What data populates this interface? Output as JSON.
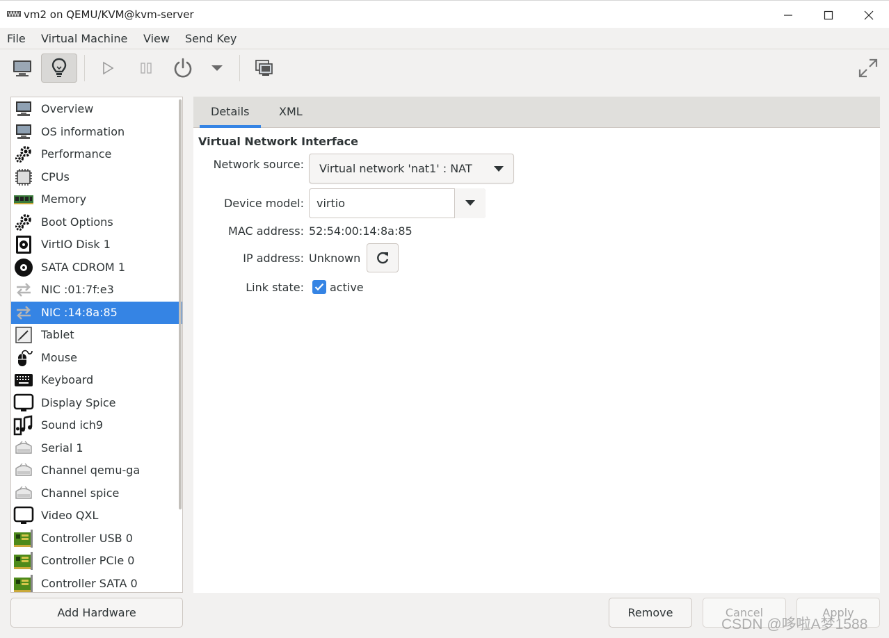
{
  "window": {
    "title": "vm2 on QEMU/KVM@kvm-server",
    "minimize": "—",
    "maximize": "☐",
    "close": "✕"
  },
  "menubar": {
    "items": [
      "File",
      "Virtual Machine",
      "View",
      "Send Key"
    ]
  },
  "toolbar": {
    "buttons": [
      {
        "name": "console",
        "icon": "monitor-icon",
        "active": false
      },
      {
        "name": "details",
        "icon": "lightbulb-icon",
        "active": true
      },
      {
        "name": "run",
        "icon": "play-icon",
        "active": false
      },
      {
        "name": "pause",
        "icon": "pause-icon",
        "active": false
      },
      {
        "name": "shutdown",
        "icon": "power-icon",
        "active": false
      },
      {
        "name": "shutdown-menu",
        "icon": "chevron-down-icon",
        "active": false
      },
      {
        "name": "snapshots",
        "icon": "snapshot-icon",
        "active": false
      },
      {
        "name": "fullscreen",
        "icon": "fullscreen-icon",
        "active": false
      }
    ]
  },
  "sidebar": {
    "items": [
      {
        "label": "Overview",
        "icon": "monitor-icon"
      },
      {
        "label": "OS information",
        "icon": "monitor-icon"
      },
      {
        "label": "Performance",
        "icon": "gears-icon"
      },
      {
        "label": "CPUs",
        "icon": "chip-icon"
      },
      {
        "label": "Memory",
        "icon": "memory-icon"
      },
      {
        "label": "Boot Options",
        "icon": "gears-icon"
      },
      {
        "label": "VirtIO Disk 1",
        "icon": "disk-icon"
      },
      {
        "label": "SATA CDROM 1",
        "icon": "cdrom-icon"
      },
      {
        "label": "NIC :01:7f:e3",
        "icon": "network-icon"
      },
      {
        "label": "NIC :14:8a:85",
        "icon": "network-icon",
        "selected": true
      },
      {
        "label": "Tablet",
        "icon": "tablet-icon"
      },
      {
        "label": "Mouse",
        "icon": "mouse-icon"
      },
      {
        "label": "Keyboard",
        "icon": "keyboard-icon"
      },
      {
        "label": "Display Spice",
        "icon": "display-icon"
      },
      {
        "label": "Sound ich9",
        "icon": "sound-icon"
      },
      {
        "label": "Serial 1",
        "icon": "serial-icon"
      },
      {
        "label": "Channel qemu-ga",
        "icon": "serial-icon"
      },
      {
        "label": "Channel spice",
        "icon": "serial-icon"
      },
      {
        "label": "Video QXL",
        "icon": "display-icon"
      },
      {
        "label": "Controller USB 0",
        "icon": "controller-icon"
      },
      {
        "label": "Controller PCIe 0",
        "icon": "controller-icon"
      },
      {
        "label": "Controller SATA 0",
        "icon": "controller-icon"
      }
    ],
    "add_hardware": "Add Hardware"
  },
  "details": {
    "tabs": [
      {
        "label": "Details",
        "active": true
      },
      {
        "label": "XML",
        "active": false
      }
    ],
    "section_title": "Virtual Network Interface",
    "network_source_label": "Network source:",
    "network_source_value": "Virtual network 'nat1' : NAT",
    "device_model_label": "Device model:",
    "device_model_value": "virtio",
    "mac_label": "MAC address:",
    "mac_value": "52:54:00:14:8a:85",
    "ip_label": "IP address:",
    "ip_value": "Unknown",
    "link_label": "Link state:",
    "link_value": "active",
    "link_checked": true
  },
  "footer": {
    "remove": "Remove",
    "cancel": "Cancel",
    "apply": "Apply",
    "watermark": "CSDN @哆啦A梦1588"
  },
  "colors": {
    "accent": "#3584e4",
    "window_bg": "#f2f1f0"
  }
}
